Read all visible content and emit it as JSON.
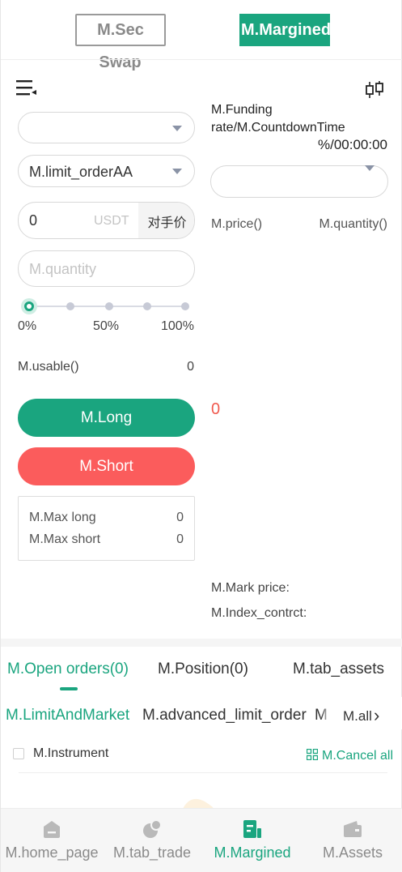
{
  "header": {
    "mode_sec": "M.Sec",
    "mode_margined": "M.Margined",
    "title": "Swap"
  },
  "funding": {
    "label": "M.Funding rate/M.CountdownTime",
    "value": "%/00:00:00"
  },
  "order_form": {
    "order_type": "M.limit_orderAA",
    "price_value": "0",
    "price_unit": "USDT",
    "counterparty_btn": "对手价",
    "quantity_placeholder": "M.quantity",
    "slider_marks": [
      "0%",
      "50%",
      "100%"
    ],
    "slider_value": 0,
    "usable_label": "M.usable()",
    "usable_value": "0",
    "long_btn": "M.Long",
    "short_btn": "M.Short",
    "max_long_label": "M.Max long",
    "max_long_value": "0",
    "max_short_label": "M.Max short",
    "max_short_value": "0"
  },
  "orderbook": {
    "price_header": "M.price()",
    "quantity_header": "M.quantity()",
    "last_price": "0",
    "mark_price_label": "M.Mark price:",
    "index_label": "M.Index_contrct:"
  },
  "orders": {
    "tabs": [
      "M.Open orders(0)",
      "M.Position(0)",
      "M.tab_assets"
    ],
    "subtabs": [
      "M.LimitAndMarket",
      "M.advanced_limit_order",
      "M"
    ],
    "all_label": "M.all",
    "instrument_label": "M.Instrument",
    "cancel_all": "M.Cancel all"
  },
  "bottom_nav": [
    "M.home_page",
    "M.tab_trade",
    "M.Margined",
    "M.Assets"
  ],
  "colors": {
    "accent": "#1aa57f",
    "long": "#1aa57f",
    "short": "#fb5c5c",
    "price_red": "#f05a4f"
  }
}
